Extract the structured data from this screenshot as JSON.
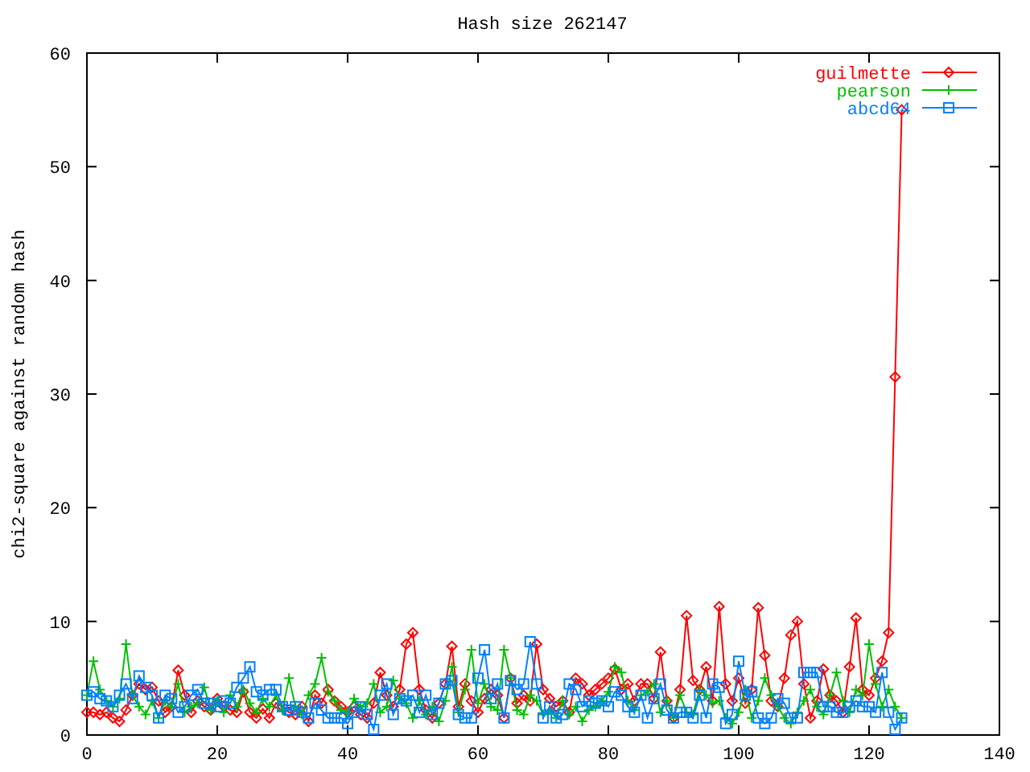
{
  "chart_data": {
    "type": "line",
    "title": "Hash size 262147",
    "ylabel": "chi2-square against random hash",
    "x": [
      0,
      1,
      2,
      3,
      4,
      5,
      6,
      7,
      8,
      9,
      10,
      11,
      12,
      13,
      14,
      15,
      16,
      17,
      18,
      19,
      20,
      21,
      22,
      23,
      24,
      25,
      26,
      27,
      28,
      29,
      30,
      31,
      32,
      33,
      34,
      35,
      36,
      37,
      38,
      39,
      40,
      41,
      42,
      43,
      44,
      45,
      46,
      47,
      48,
      49,
      50,
      51,
      52,
      53,
      54,
      55,
      56,
      57,
      58,
      59,
      60,
      61,
      62,
      63,
      64,
      65,
      66,
      67,
      68,
      69,
      70,
      71,
      72,
      73,
      74,
      75,
      76,
      77,
      78,
      79,
      80,
      81,
      82,
      83,
      84,
      85,
      86,
      87,
      88,
      89,
      90,
      91,
      92,
      93,
      94,
      95,
      96,
      97,
      98,
      99,
      100,
      101,
      102,
      103,
      104,
      105,
      106,
      107,
      108,
      109,
      110,
      111,
      112,
      113,
      114,
      115,
      116,
      117,
      118,
      119,
      120,
      121,
      122,
      123,
      124,
      125
    ],
    "legend": true,
    "xlim": [
      0,
      140
    ],
    "ylim": [
      0,
      60
    ],
    "xticks": [
      0,
      20,
      40,
      60,
      80,
      100,
      120,
      140
    ],
    "yticks": [
      0,
      10,
      20,
      30,
      40,
      50,
      60
    ],
    "series": [
      {
        "name": "guilmette",
        "color": "#ff0000",
        "marker": "diamond",
        "values": [
          2,
          2,
          1.8,
          2,
          1.5,
          1.2,
          2.2,
          3.5,
          4.5,
          4,
          4.2,
          3,
          2,
          2.5,
          5.7,
          3.5,
          2,
          3,
          2.5,
          2.2,
          3.2,
          2.5,
          2.2,
          2,
          3.8,
          2,
          1.5,
          2.3,
          1.5,
          2.8,
          2.5,
          2,
          1.8,
          2.5,
          1.2,
          3.5,
          2.8,
          4,
          3,
          2.5,
          2,
          2.5,
          1.8,
          1.5,
          2.8,
          5.5,
          3.5,
          2.5,
          4,
          8,
          9,
          4,
          2.2,
          1.5,
          2.8,
          4.5,
          7.8,
          2.5,
          4.5,
          3,
          2,
          3.2,
          4,
          3.5,
          1.5,
          5,
          2.8,
          3.5,
          3,
          8,
          4,
          3.2,
          2.5,
          3,
          2,
          5,
          4.5,
          3.5,
          4,
          4.5,
          5,
          5.8,
          4,
          4.5,
          3,
          4.5,
          4.5,
          3.2,
          7.3,
          3,
          1.5,
          4,
          10.5,
          4.8,
          4,
          6,
          3,
          11.3,
          4.5,
          3,
          5,
          2.8,
          4,
          11.2,
          7,
          3,
          2.5,
          5,
          8.8,
          10,
          4.5,
          1.5,
          3,
          5.8,
          3.5,
          3,
          2,
          6,
          10.3,
          4,
          3.5,
          5,
          6.5,
          9,
          31.5,
          55
        ]
      },
      {
        "name": "pearson",
        "color": "#00c000",
        "marker": "plus",
        "values": [
          3.5,
          6.5,
          4,
          3,
          2.5,
          3.2,
          8,
          3.5,
          2.5,
          1.8,
          3,
          1.5,
          3,
          2.5,
          4.5,
          2,
          2.5,
          2.8,
          4.2,
          2.2,
          3,
          2,
          3.5,
          2.5,
          4,
          2.8,
          2,
          3.2,
          2.5,
          3.5,
          2.2,
          5,
          2.5,
          1.8,
          3.5,
          4.5,
          6.8,
          3.8,
          3,
          2.2,
          2,
          3.2,
          2.5,
          2.8,
          4.5,
          2,
          2.5,
          4.8,
          3.2,
          2.8,
          1.5,
          3,
          1.8,
          2.5,
          1.2,
          3,
          6,
          2,
          4,
          7.5,
          2.8,
          4.5,
          2.5,
          2.2,
          7.5,
          5,
          2.2,
          1.8,
          3.5,
          3,
          1.8,
          2.2,
          1.5,
          3,
          1.8,
          2.5,
          1.2,
          2.2,
          2.5,
          3,
          3.8,
          6,
          5.5,
          3,
          2.2,
          3.5,
          3.8,
          4.5,
          2,
          3,
          1.5,
          3.5,
          2,
          1.8,
          4,
          3.5,
          2.8,
          3,
          1.5,
          1,
          2,
          4,
          1.5,
          3,
          5,
          3.5,
          2.5,
          1.5,
          1,
          2,
          3,
          4,
          2.5,
          1.8,
          3.5,
          5.5,
          3,
          2,
          4,
          3.5,
          8,
          4.5,
          2.5,
          4,
          2.5,
          1.5
        ]
      },
      {
        "name": "abcd64",
        "color": "#0080ff",
        "marker": "square",
        "values": [
          3.5,
          3.8,
          3.2,
          3,
          2.5,
          3.5,
          4.5,
          3.2,
          5.2,
          4.2,
          3.5,
          1.5,
          3.5,
          3.2,
          2,
          2.5,
          3.5,
          4,
          2.8,
          2.8,
          2.5,
          3,
          2.8,
          4.2,
          5,
          6,
          3.8,
          3.5,
          4,
          4,
          2.5,
          2.2,
          2.5,
          2,
          1.5,
          2.8,
          2.2,
          1.5,
          1.5,
          1.5,
          1,
          2,
          2.5,
          1.8,
          0.5,
          3.5,
          4.5,
          1.8,
          3.2,
          3,
          3.5,
          2,
          3.5,
          1.8,
          2.8,
          4.5,
          4.8,
          1.8,
          1.5,
          1.5,
          5,
          7.5,
          3.2,
          4.5,
          1.5,
          4.8,
          4,
          4.5,
          8.2,
          4.5,
          1.5,
          2.5,
          1.5,
          1.8,
          4.5,
          4,
          2.5,
          3,
          2.8,
          3,
          2.5,
          3.8,
          3.5,
          2.5,
          2,
          3.5,
          1.5,
          3.2,
          4.5,
          2.2,
          1.5,
          2,
          2,
          1.5,
          3.5,
          1.5,
          4.5,
          4.2,
          1,
          1.8,
          6.5,
          3.5,
          3.8,
          1.5,
          1,
          1.5,
          3.2,
          2.8,
          1.5,
          1.5,
          5.5,
          5.5,
          5.5,
          2.5,
          2.5,
          2,
          2,
          2.5,
          3,
          2.5,
          2.5,
          2,
          5.5,
          2,
          0.5,
          1.5
        ]
      }
    ]
  }
}
